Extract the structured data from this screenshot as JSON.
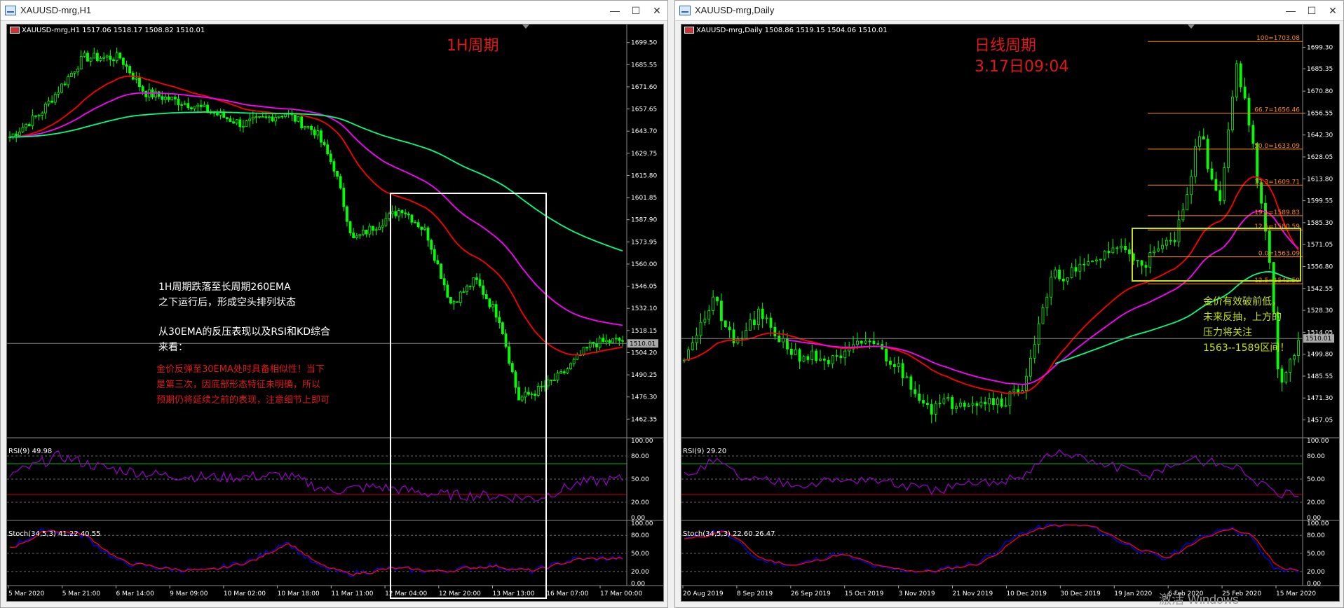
{
  "colors": {
    "candle": "#00ff00",
    "ema30": "#ff0000",
    "ema_mid": "#ff00ff",
    "ema260": "#00ff7f",
    "rsi_line": "#9900cc",
    "stoch_main": "#0000ff",
    "stoch_signal": "#ff0000",
    "title_text": "#e01818",
    "note_yellow": "#c6e012",
    "fib_line": "#ff8c00",
    "bid_line": "#808080"
  },
  "window_left": {
    "title": "XAUUSD-mrg,H1",
    "info": "XAUUSD-mrg,H1  1517.06 1518.17 1508.82 1510.01",
    "period_title": "1H周期",
    "annotation_white_1": "1H周期跌落至长周期260EMA",
    "annotation_white_2": "之下运行后，形成空头排列状态",
    "annotation_white_3": "从30EMA的反压表现以及RSI和KD综合",
    "annotation_white_4": "来看：",
    "annotation_red_1": "金价反弹至30EMA处时具备相似性！当下",
    "annotation_red_2": "是第三次，因底部形态特征未明确，所以",
    "annotation_red_3": "预期仍将延续之前的表现，注意细节上即可",
    "price_ticks": [
      "1699.50",
      "1685.55",
      "1671.60",
      "1657.65",
      "1643.70",
      "1629.75",
      "1615.80",
      "1601.85",
      "1587.90",
      "1573.95",
      "1560.00",
      "1546.05",
      "1532.10",
      "1518.15",
      "1504.20",
      "1490.25",
      "1476.30",
      "1462.35"
    ],
    "current_price": "1510.01",
    "rsi_label": "RSI(9) 49.98",
    "rsi_ticks": [
      "100.00",
      "80.00",
      "50.00",
      "20.00",
      "0.00"
    ],
    "stoch_label": "Stoch(34,5,3) 41.22 40.55",
    "stoch_ticks": [
      "100.00",
      "80.00",
      "50.00",
      "20.00",
      "0.00"
    ],
    "time_labels": [
      "5 Mar 2020",
      "5 Mar 21:00",
      "6 Mar 14:00",
      "9 Mar 09:00",
      "10 Mar 02:00",
      "10 Mar 18:00",
      "11 Mar 11:00",
      "12 Mar 04:00",
      "12 Mar 20:00",
      "13 Mar 13:00",
      "16 Mar 07:00",
      "17 Mar 00:00"
    ]
  },
  "window_right": {
    "title": "XAUUSD-mrg,Daily",
    "info": "XAUUSD-mrg,Daily  1508.86 1519.15 1504.06 1510.01",
    "period_title_1": "日线周期",
    "period_title_2": "3.17日09:04",
    "note_1": "金价有效破前低，",
    "note_2": "未来反抽，上方的",
    "note_3": "压力将关注",
    "note_4": "1563--1589区间！",
    "price_ticks": [
      "1699.30",
      "1685.35",
      "1670.80",
      "1656.55",
      "1642.30",
      "1628.05",
      "1613.80",
      "1599.55",
      "1585.30",
      "1571.05",
      "1556.80",
      "1542.55",
      "1528.30",
      "1514.05",
      "1499.80",
      "1485.55",
      "1471.30",
      "1457.05"
    ],
    "current_price": "1510.01",
    "fib_levels": [
      {
        "label": "100=1703.08",
        "value": 1703.08
      },
      {
        "label": "66.7=1656.46",
        "value": 1656.46
      },
      {
        "label": "50.0=1633.09",
        "value": 1633.09
      },
      {
        "label": "33.3=1609.71",
        "value": 1609.71
      },
      {
        "label": "19.1=1589.83",
        "value": 1589.83
      },
      {
        "label": "12.5=1580.59",
        "value": 1580.59
      },
      {
        "label": "0.0=1563.09",
        "value": 1563.09
      },
      {
        "label": "-12.5=1545.59",
        "value": 1545.59
      }
    ],
    "rsi_label": "RSI(9) 29.20",
    "rsi_ticks": [
      "100.00",
      "80.00",
      "50.00",
      "20.00",
      "0.00"
    ],
    "stoch_label": "Stoch(34,5,3) 22.60 26.47",
    "stoch_ticks": [
      "100.00",
      "80.00",
      "50.00",
      "20.00",
      "0.00"
    ],
    "time_labels": [
      "20 Aug 2019",
      "8 Sep 2019",
      "26 Sep 2019",
      "15 Oct 2019",
      "3 Nov 2019",
      "21 Nov 2019",
      "10 Dec 2019",
      "30 Dec 2019",
      "19 Jan 2020",
      "6 Feb 2020",
      "25 Feb 2020",
      "15 Mar 2020"
    ]
  },
  "buttons": {
    "minimize": "—",
    "maximize": "☐",
    "close": "✕"
  },
  "watermark": "激活 Windows"
}
